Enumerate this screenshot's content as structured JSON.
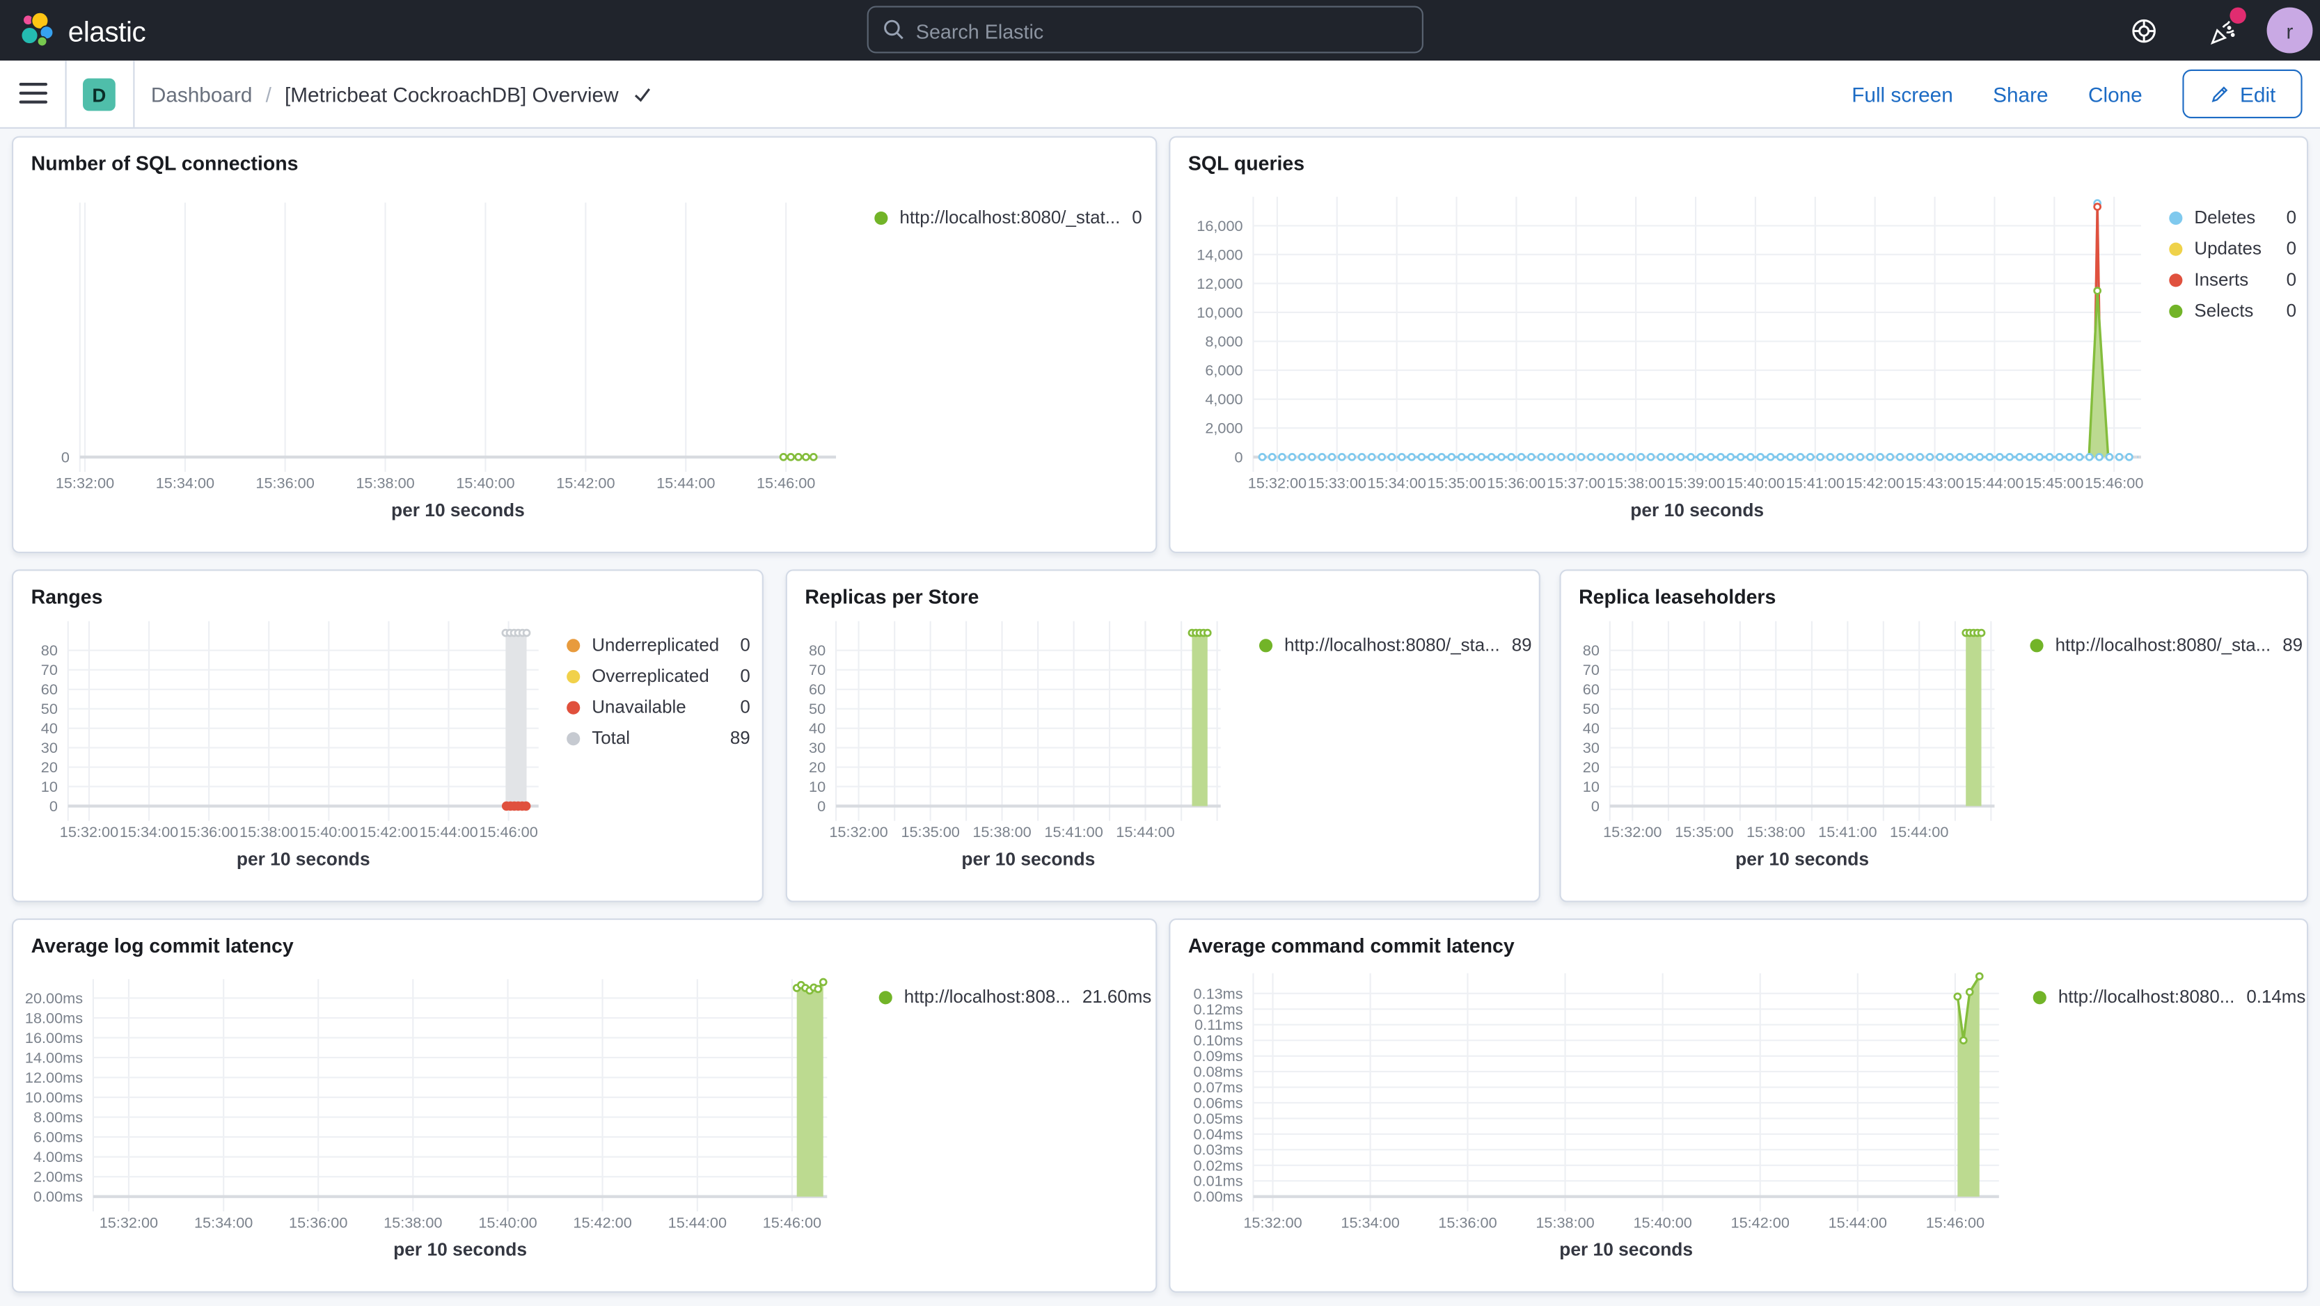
{
  "colors": {
    "header_bg": "#20242C",
    "accent_blue": "#1C6BC4",
    "badge_teal": "#4FBEAA",
    "avatar_purple": "#C9A9E4",
    "notification_pink": "#E12C70",
    "panel_border": "#D3DAE6",
    "page_bg": "#F5F7FA",
    "series_green": "#84BD3C",
    "series_green_fill": "#BCDA90"
  },
  "header": {
    "logo_text": "elastic",
    "search_placeholder": "Search Elastic",
    "avatar_letter": "r",
    "icons": [
      "help-icon",
      "news-icon",
      "user-avatar"
    ]
  },
  "toolbar": {
    "space_letter": "D",
    "breadcrumb": {
      "root": "Dashboard",
      "separator": "/",
      "current": "[Metricbeat CockroachDB] Overview"
    },
    "actions": [
      {
        "label": "Full screen"
      },
      {
        "label": "Share"
      },
      {
        "label": "Clone"
      }
    ],
    "edit_label": "Edit"
  },
  "panels": [
    {
      "title": "Number of SQL connections",
      "legend": [
        {
          "color": "#72B428",
          "label": "http://localhost:8080/_stat...",
          "value": "0"
        }
      ]
    },
    {
      "title": "SQL queries",
      "legend": [
        {
          "color": "#7FC9EE",
          "label": "Deletes",
          "value": "0"
        },
        {
          "color": "#EFD24A",
          "label": "Updates",
          "value": "0"
        },
        {
          "color": "#E0513E",
          "label": "Inserts",
          "value": "0"
        },
        {
          "color": "#72B428",
          "label": "Selects",
          "value": "0"
        }
      ]
    },
    {
      "title": "Ranges",
      "legend": [
        {
          "color": "#E89B3D",
          "label": "Underreplicated",
          "value": "0"
        },
        {
          "color": "#F1D14A",
          "label": "Overreplicated",
          "value": "0"
        },
        {
          "color": "#E0503C",
          "label": "Unavailable",
          "value": "0"
        },
        {
          "color": "#C6CAD1",
          "label": "Total",
          "value": "89"
        }
      ]
    },
    {
      "title": "Replicas per Store",
      "legend": [
        {
          "color": "#72B428",
          "label": "http://localhost:8080/_sta...",
          "value": "89"
        }
      ]
    },
    {
      "title": "Replica leaseholders",
      "legend": [
        {
          "color": "#72B428",
          "label": "http://localhost:8080/_sta...",
          "value": "89"
        }
      ]
    },
    {
      "title": "Average log commit latency",
      "legend": [
        {
          "color": "#72B428",
          "label": "http://localhost:808...",
          "value": "21.60ms"
        }
      ]
    },
    {
      "title": "Average command commit latency",
      "legend": [
        {
          "color": "#72B428",
          "label": "http://localhost:8080...",
          "value": "0.14ms"
        }
      ]
    }
  ],
  "chart_data": [
    {
      "id": "sql_connections",
      "type": "line",
      "title": "Number of SQL connections",
      "xlabel": "per 10 seconds",
      "margins": {
        "l": 45,
        "r": 216,
        "t": 44,
        "b": 64
      },
      "xlim": [
        31.9,
        47.0
      ],
      "ylim": [
        0,
        10
      ],
      "y_ticks": [
        {
          "v": 0,
          "l": "0"
        }
      ],
      "x_ticks": [
        {
          "v": 32,
          "l": "15:32:00"
        },
        {
          "v": 34,
          "l": "15:34:00"
        },
        {
          "v": 36,
          "l": "15:36:00"
        },
        {
          "v": 38,
          "l": "15:38:00"
        },
        {
          "v": 40,
          "l": "15:40:00"
        },
        {
          "v": 42,
          "l": "15:42:00"
        },
        {
          "v": 44,
          "l": "15:44:00"
        },
        {
          "v": 46,
          "l": "15:46:00"
        }
      ],
      "v_gridlines": [
        32,
        34,
        36,
        38,
        40,
        42,
        44,
        46
      ],
      "series": [
        {
          "name": "http://localhost:8080/_stat...",
          "kind": "line",
          "color": "#84BD3C",
          "marker": "all",
          "points": [
            [
              45.95,
              0
            ],
            [
              46.1,
              0
            ],
            [
              46.25,
              0
            ],
            [
              46.4,
              0
            ],
            [
              46.55,
              0
            ]
          ]
        }
      ]
    },
    {
      "id": "sql_queries",
      "type": "line",
      "title": "SQL queries",
      "xlabel": "per 10 seconds",
      "margins": {
        "l": 56,
        "r": 112,
        "t": 40,
        "b": 64
      },
      "xlim": [
        31.6,
        46.45
      ],
      "ylim": [
        0,
        18000
      ],
      "y_ticks": [
        {
          "v": 0,
          "l": "0"
        },
        {
          "v": 2000,
          "l": "2,000"
        },
        {
          "v": 4000,
          "l": "4,000"
        },
        {
          "v": 6000,
          "l": "6,000"
        },
        {
          "v": 8000,
          "l": "8,000"
        },
        {
          "v": 10000,
          "l": "10,000"
        },
        {
          "v": 12000,
          "l": "12,000"
        },
        {
          "v": 14000,
          "l": "14,000"
        },
        {
          "v": 16000,
          "l": "16,000"
        }
      ],
      "x_ticks": [
        {
          "v": 32,
          "l": "15:32:00"
        },
        {
          "v": 33,
          "l": "15:33:00"
        },
        {
          "v": 34,
          "l": "15:34:00"
        },
        {
          "v": 35,
          "l": "15:35:00"
        },
        {
          "v": 36,
          "l": "15:36:00"
        },
        {
          "v": 37,
          "l": "15:37:00"
        },
        {
          "v": 38,
          "l": "15:38:00"
        },
        {
          "v": 39,
          "l": "15:39:00"
        },
        {
          "v": 40,
          "l": "15:40:00"
        },
        {
          "v": 41,
          "l": "15:41:00"
        },
        {
          "v": 42,
          "l": "15:42:00"
        },
        {
          "v": 43,
          "l": "15:43:00"
        },
        {
          "v": 44,
          "l": "15:44:00"
        },
        {
          "v": 45,
          "l": "15:45:00"
        },
        {
          "v": 46,
          "l": "15:46:00"
        }
      ],
      "v_gridlines": [
        32,
        33,
        34,
        35,
        36,
        37,
        38,
        39,
        40,
        41,
        42,
        43,
        44,
        45,
        46
      ],
      "series": [
        {
          "name": "Deletes spike",
          "kind": "line",
          "color": "#7FC9EE",
          "marker": "peak",
          "points": [
            [
              45.66,
              0
            ],
            [
              45.72,
              17550
            ],
            [
              45.78,
              0
            ]
          ]
        },
        {
          "name": "Inserts spike",
          "kind": "line",
          "color": "#E0513E",
          "marker": "peak",
          "points": [
            [
              45.65,
              0
            ],
            [
              45.72,
              17300
            ],
            [
              45.79,
              0
            ]
          ]
        },
        {
          "name": "Selects",
          "kind": "area",
          "color": "#84BD3C",
          "fill": "#BCDA90",
          "marker": "peak",
          "points": [
            [
              45.58,
              0
            ],
            [
              45.72,
              11500
            ],
            [
              45.9,
              0
            ]
          ]
        },
        {
          "name": "Deletes baseline",
          "color": "#7FC9EE",
          "baseline": {
            "from": 31.75,
            "to": 46.4,
            "y": 0,
            "step": 0.1667
          }
        }
      ]
    },
    {
      "id": "ranges",
      "type": "line",
      "title": "Ranges",
      "xlabel": "per 10 seconds",
      "margins": {
        "l": 37,
        "r": 151,
        "t": 34,
        "b": 64
      },
      "xlim": [
        31.3,
        47.0
      ],
      "ylim": [
        0,
        95
      ],
      "y_ticks": [
        {
          "v": 0,
          "l": "0"
        },
        {
          "v": 10,
          "l": "10"
        },
        {
          "v": 20,
          "l": "20"
        },
        {
          "v": 30,
          "l": "30"
        },
        {
          "v": 40,
          "l": "40"
        },
        {
          "v": 50,
          "l": "50"
        },
        {
          "v": 60,
          "l": "60"
        },
        {
          "v": 70,
          "l": "70"
        },
        {
          "v": 80,
          "l": "80"
        }
      ],
      "x_ticks": [
        {
          "v": 32,
          "l": "15:32:00"
        },
        {
          "v": 34,
          "l": "15:34:00"
        },
        {
          "v": 36,
          "l": "15:36:00"
        },
        {
          "v": 38,
          "l": "15:38:00"
        },
        {
          "v": 40,
          "l": "15:40:00"
        },
        {
          "v": 42,
          "l": "15:42:00"
        },
        {
          "v": 44,
          "l": "15:44:00"
        },
        {
          "v": 46,
          "l": "15:46:00"
        }
      ],
      "v_gridlines": [
        32,
        34,
        36,
        38,
        40,
        42,
        44,
        46
      ],
      "series": [
        {
          "name": "Total",
          "kind": "area",
          "color": "#D5D8DC",
          "fill": "#E2E4E7",
          "marker": "all",
          "mcolor": "#C9CDD2",
          "points": [
            [
              45.9,
              89
            ],
            [
              46.04,
              89
            ],
            [
              46.18,
              89
            ],
            [
              46.32,
              89
            ],
            [
              46.46,
              89
            ],
            [
              46.6,
              89
            ]
          ]
        },
        {
          "name": "Unavailable",
          "kind": "dots",
          "color": "#E0513E",
          "points": [
            [
              45.93,
              0
            ],
            [
              46.06,
              0
            ],
            [
              46.19,
              0
            ],
            [
              46.32,
              0
            ],
            [
              46.45,
              0
            ],
            [
              46.58,
              0
            ]
          ]
        }
      ]
    },
    {
      "id": "replicas_per_store",
      "type": "line",
      "title": "Replicas per Store",
      "xlabel": "per 10 seconds",
      "margins": {
        "l": 33,
        "r": 215,
        "t": 34,
        "b": 64
      },
      "xlim": [
        31.05,
        47.15
      ],
      "ylim": [
        0,
        95
      ],
      "y_ticks": [
        {
          "v": 0,
          "l": "0"
        },
        {
          "v": 10,
          "l": "10"
        },
        {
          "v": 20,
          "l": "20"
        },
        {
          "v": 30,
          "l": "30"
        },
        {
          "v": 40,
          "l": "40"
        },
        {
          "v": 50,
          "l": "50"
        },
        {
          "v": 60,
          "l": "60"
        },
        {
          "v": 70,
          "l": "70"
        },
        {
          "v": 80,
          "l": "80"
        }
      ],
      "x_ticks": [
        {
          "v": 32,
          "l": "15:32:00"
        },
        {
          "v": 35,
          "l": "15:35:00"
        },
        {
          "v": 38,
          "l": "15:38:00"
        },
        {
          "v": 41,
          "l": "15:41:00"
        },
        {
          "v": 44,
          "l": "15:44:00"
        }
      ],
      "v_gridlines": [
        32,
        33.5,
        35,
        36.5,
        38,
        39.5,
        41,
        42.5,
        44,
        45.5,
        47
      ],
      "series": [
        {
          "name": "http://localhost:8080/_sta...",
          "kind": "area",
          "color": "#84BD3C",
          "fill": "#BCDA90",
          "marker": "all",
          "points": [
            [
              45.95,
              89
            ],
            [
              46.11,
              89
            ],
            [
              46.27,
              89
            ],
            [
              46.43,
              89
            ],
            [
              46.6,
              89
            ]
          ]
        }
      ]
    },
    {
      "id": "replica_leaseholders",
      "type": "line",
      "title": "Replica leaseholders",
      "xlabel": "per 10 seconds",
      "margins": {
        "l": 33,
        "r": 211,
        "t": 34,
        "b": 64
      },
      "xlim": [
        31.05,
        47.15
      ],
      "ylim": [
        0,
        95
      ],
      "y_ticks": [
        {
          "v": 0,
          "l": "0"
        },
        {
          "v": 10,
          "l": "10"
        },
        {
          "v": 20,
          "l": "20"
        },
        {
          "v": 30,
          "l": "30"
        },
        {
          "v": 40,
          "l": "40"
        },
        {
          "v": 50,
          "l": "50"
        },
        {
          "v": 60,
          "l": "60"
        },
        {
          "v": 70,
          "l": "70"
        },
        {
          "v": 80,
          "l": "80"
        }
      ],
      "x_ticks": [
        {
          "v": 32,
          "l": "15:32:00"
        },
        {
          "v": 35,
          "l": "15:35:00"
        },
        {
          "v": 38,
          "l": "15:38:00"
        },
        {
          "v": 41,
          "l": "15:41:00"
        },
        {
          "v": 44,
          "l": "15:44:00"
        }
      ],
      "v_gridlines": [
        32,
        33.5,
        35,
        36.5,
        38,
        39.5,
        41,
        42.5,
        44,
        45.5,
        47
      ],
      "series": [
        {
          "name": "http://localhost:8080/_sta...",
          "kind": "area",
          "color": "#84BD3C",
          "fill": "#BCDA90",
          "marker": "all",
          "points": [
            [
              45.95,
              89
            ],
            [
              46.11,
              89
            ],
            [
              46.27,
              89
            ],
            [
              46.43,
              89
            ],
            [
              46.6,
              89
            ]
          ]
        }
      ]
    },
    {
      "id": "avg_log_commit_latency",
      "type": "line",
      "title": "Average log commit latency",
      "xlabel": "per 10 seconds",
      "margins": {
        "l": 54,
        "r": 222,
        "t": 40,
        "b": 64
      },
      "xlim": [
        31.25,
        46.74
      ],
      "ylim": [
        0,
        21.9
      ],
      "y_ticks": [
        {
          "v": 0,
          "l": "0.00ms"
        },
        {
          "v": 2,
          "l": "2.00ms"
        },
        {
          "v": 4,
          "l": "4.00ms"
        },
        {
          "v": 6,
          "l": "6.00ms"
        },
        {
          "v": 8,
          "l": "8.00ms"
        },
        {
          "v": 10,
          "l": "10.00ms"
        },
        {
          "v": 12,
          "l": "12.00ms"
        },
        {
          "v": 14,
          "l": "14.00ms"
        },
        {
          "v": 16,
          "l": "16.00ms"
        },
        {
          "v": 18,
          "l": "18.00ms"
        },
        {
          "v": 20,
          "l": "20.00ms"
        }
      ],
      "x_ticks": [
        {
          "v": 32,
          "l": "15:32:00"
        },
        {
          "v": 34,
          "l": "15:34:00"
        },
        {
          "v": 36,
          "l": "15:36:00"
        },
        {
          "v": 38,
          "l": "15:38:00"
        },
        {
          "v": 40,
          "l": "15:40:00"
        },
        {
          "v": 42,
          "l": "15:42:00"
        },
        {
          "v": 44,
          "l": "15:44:00"
        },
        {
          "v": 46,
          "l": "15:46:00"
        }
      ],
      "v_gridlines": [
        32,
        34,
        36,
        38,
        40,
        42,
        44,
        46
      ],
      "series": [
        {
          "name": "http://localhost:808...",
          "kind": "area",
          "color": "#84BD3C",
          "fill": "#BCDA90",
          "marker": "all",
          "points": [
            [
              46.1,
              21.0
            ],
            [
              46.19,
              21.3
            ],
            [
              46.28,
              21.0
            ],
            [
              46.37,
              20.75
            ],
            [
              46.46,
              21.05
            ],
            [
              46.55,
              20.9
            ],
            [
              46.66,
              21.6
            ]
          ]
        }
      ]
    },
    {
      "id": "avg_command_commit_latency",
      "type": "line",
      "title": "Average command commit latency",
      "xlabel": "per 10 seconds",
      "margins": {
        "l": 56,
        "r": 208,
        "t": 36,
        "b": 64
      },
      "xlim": [
        31.6,
        46.9
      ],
      "ylim": [
        0,
        0.143
      ],
      "y_ticks": [
        {
          "v": 0,
          "l": "0.00ms"
        },
        {
          "v": 0.01,
          "l": "0.01ms"
        },
        {
          "v": 0.02,
          "l": "0.02ms"
        },
        {
          "v": 0.03,
          "l": "0.03ms"
        },
        {
          "v": 0.04,
          "l": "0.04ms"
        },
        {
          "v": 0.05,
          "l": "0.05ms"
        },
        {
          "v": 0.06,
          "l": "0.06ms"
        },
        {
          "v": 0.07,
          "l": "0.07ms"
        },
        {
          "v": 0.08,
          "l": "0.08ms"
        },
        {
          "v": 0.09,
          "l": "0.09ms"
        },
        {
          "v": 0.1,
          "l": "0.10ms"
        },
        {
          "v": 0.11,
          "l": "0.11ms"
        },
        {
          "v": 0.12,
          "l": "0.12ms"
        },
        {
          "v": 0.13,
          "l": "0.13ms"
        }
      ],
      "x_ticks": [
        {
          "v": 32,
          "l": "15:32:00"
        },
        {
          "v": 34,
          "l": "15:34:00"
        },
        {
          "v": 36,
          "l": "15:36:00"
        },
        {
          "v": 38,
          "l": "15:38:00"
        },
        {
          "v": 40,
          "l": "15:40:00"
        },
        {
          "v": 42,
          "l": "15:42:00"
        },
        {
          "v": 44,
          "l": "15:44:00"
        },
        {
          "v": 46,
          "l": "15:46:00"
        }
      ],
      "v_gridlines": [
        32,
        34,
        36,
        38,
        40,
        42,
        44,
        46
      ],
      "series": [
        {
          "name": "http://localhost:8080...",
          "kind": "area",
          "color": "#84BD3C",
          "fill": "#BCDA90",
          "marker": "all",
          "points": [
            [
              46.05,
              0.128
            ],
            [
              46.17,
              0.1
            ],
            [
              46.3,
              0.131
            ],
            [
              46.5,
              0.141
            ]
          ]
        }
      ]
    }
  ]
}
